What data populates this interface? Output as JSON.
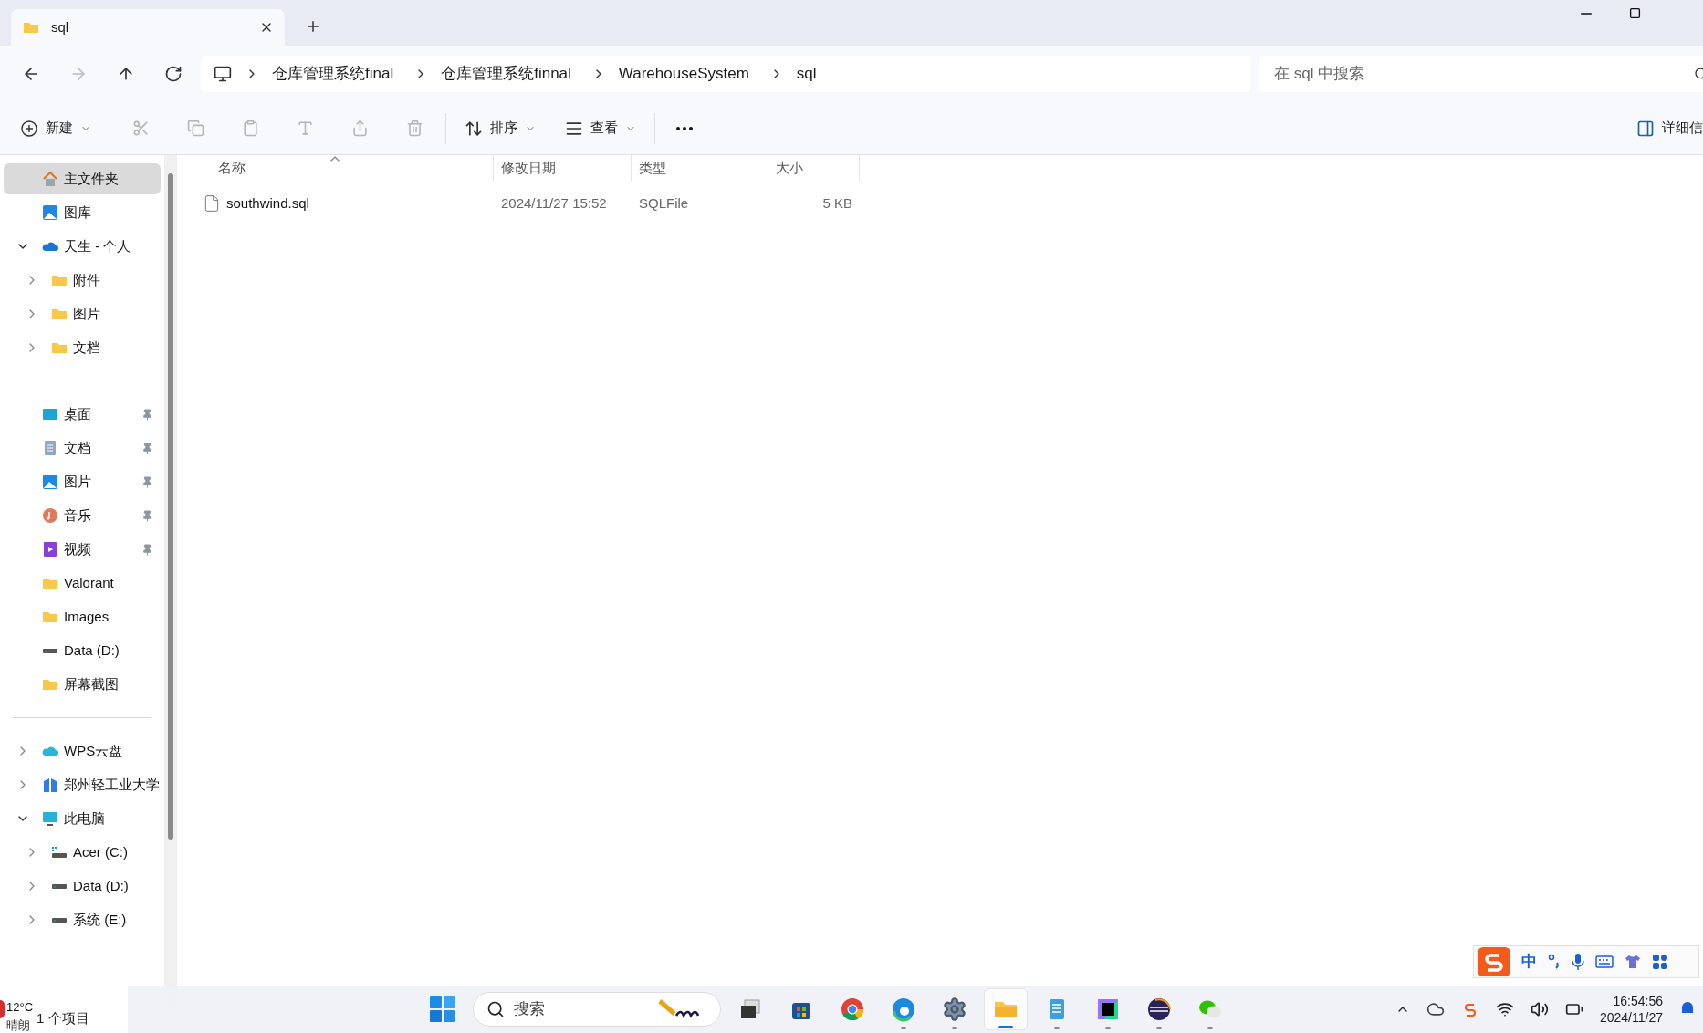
{
  "tab": {
    "title": "sql"
  },
  "breadcrumb": [
    "仓库管理系统final",
    "仓库管理系统finnal",
    "WarehouseSystem",
    "sql"
  ],
  "search": {
    "placeholder": "在 sql 中搜索"
  },
  "toolbar": {
    "new": "新建",
    "sort": "排序",
    "view": "查看",
    "details": "详细信"
  },
  "sidebar": {
    "groups": [
      {
        "items": [
          {
            "label": "主文件夹",
            "kind": "home",
            "selected": true
          },
          {
            "label": "图库",
            "kind": "gallery",
            "selected": false
          },
          {
            "label": "天生 - 个人",
            "kind": "cloud",
            "selected": false,
            "expanded": true,
            "children": [
              {
                "label": "附件",
                "kind": "folder",
                "selected": false,
                "expanded": false
              },
              {
                "label": "图片",
                "kind": "folder",
                "selected": false,
                "expanded": false
              },
              {
                "label": "文档",
                "kind": "folder",
                "selected": false,
                "expanded": false
              }
            ]
          }
        ]
      },
      {
        "items": [
          {
            "label": "桌面",
            "kind": "desktop",
            "selected": false,
            "pinned": true
          },
          {
            "label": "文档",
            "kind": "document",
            "selected": false,
            "pinned": true
          },
          {
            "label": "图片",
            "kind": "gallery",
            "selected": false,
            "pinned": true
          },
          {
            "label": "音乐",
            "kind": "music",
            "selected": false,
            "pinned": true
          },
          {
            "label": "视频",
            "kind": "video",
            "selected": false,
            "pinned": true
          },
          {
            "label": "Valorant",
            "kind": "folder",
            "selected": false,
            "pinned": false
          },
          {
            "label": "Images",
            "kind": "folder",
            "selected": false,
            "pinned": false
          },
          {
            "label": "Data (D:)",
            "kind": "drive",
            "selected": false,
            "pinned": false
          },
          {
            "label": "屏幕截图",
            "kind": "folder",
            "selected": false,
            "pinned": false
          }
        ]
      },
      {
        "items": [
          {
            "label": "WPS云盘",
            "kind": "wps",
            "selected": false,
            "expanded": false
          },
          {
            "label": "郑州轻工业大学",
            "kind": "building",
            "selected": false,
            "expanded": false
          },
          {
            "label": "此电脑",
            "kind": "pc",
            "selected": false,
            "expanded": true,
            "children": [
              {
                "label": "Acer (C:)",
                "kind": "sysdrive",
                "selected": false,
                "expanded": false
              },
              {
                "label": "Data (D:)",
                "kind": "drive",
                "selected": false,
                "expanded": false
              },
              {
                "label": "系统 (E:)",
                "kind": "drive",
                "selected": false,
                "expanded": false
              }
            ]
          }
        ]
      }
    ]
  },
  "table": {
    "columns": [
      {
        "label": "名称",
        "sorted": true
      },
      {
        "label": "修改日期",
        "sorted": false
      },
      {
        "label": "类型",
        "sorted": false
      },
      {
        "label": "大小",
        "sorted": false
      }
    ],
    "rows": [
      {
        "name": "southwind.sql",
        "modified": "2024/11/27 15:52",
        "type": "SQLFile",
        "size": "5 KB"
      }
    ]
  },
  "status_bar": "1 个项目",
  "weather": {
    "temperature": "12°C",
    "condition": "晴朗"
  },
  "ime": {
    "mode": "中"
  },
  "taskbar": {
    "search_placeholder": "搜索",
    "apps": [
      {
        "kind": "taskview",
        "running": false,
        "selected": false
      },
      {
        "kind": "store",
        "running": false,
        "selected": false
      },
      {
        "kind": "chrome",
        "running": false,
        "selected": false
      },
      {
        "kind": "edge",
        "running": true,
        "selected": false
      },
      {
        "kind": "settings",
        "running": true,
        "selected": false
      },
      {
        "kind": "explorer",
        "running": true,
        "selected": true
      },
      {
        "kind": "notepad",
        "running": true,
        "selected": false
      },
      {
        "kind": "datagrip",
        "running": true,
        "selected": false
      },
      {
        "kind": "eclipse",
        "running": true,
        "selected": false
      },
      {
        "kind": "wechat",
        "running": true,
        "selected": false
      }
    ],
    "time": "16:54:56",
    "date": "2024/11/27"
  }
}
